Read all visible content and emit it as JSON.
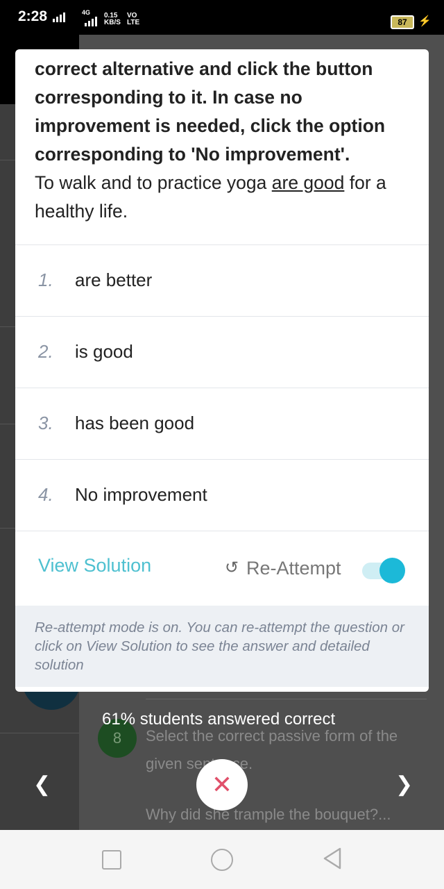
{
  "status_bar": {
    "time": "2:28",
    "network": "4G",
    "speed_value": "0.15",
    "speed_unit": "KB/S",
    "volte": "VO",
    "lte": "LTE",
    "battery": "87"
  },
  "background": {
    "question_number": "8",
    "question_text": "Select the correct passive form of the given sentence.",
    "question_sentence": "Why did she trample the bouquet?..."
  },
  "question": {
    "instruction_bold": "correct alternative and click the button corresponding to it. In case no improvement is needed, click the option corresponding to 'No improvement'.",
    "sentence_before": "To walk and to practice yoga ",
    "sentence_underlined": "are good",
    "sentence_after": " for a healthy life."
  },
  "options": [
    {
      "number": "1.",
      "text": "are better"
    },
    {
      "number": "2.",
      "text": "is good"
    },
    {
      "number": "3.",
      "text": "has been good"
    },
    {
      "number": "4.",
      "text": "No improvement"
    }
  ],
  "actions": {
    "view_solution": "View Solution",
    "reattempt": "Re-Attempt",
    "reattempt_on": true
  },
  "note": "Re-attempt mode is on. You can re-attempt the question or click on View Solution to see the answer and detailed solution",
  "stats": "61% students answered correct",
  "colors": {
    "accent": "#1cb9d8",
    "close": "#e0506a"
  }
}
